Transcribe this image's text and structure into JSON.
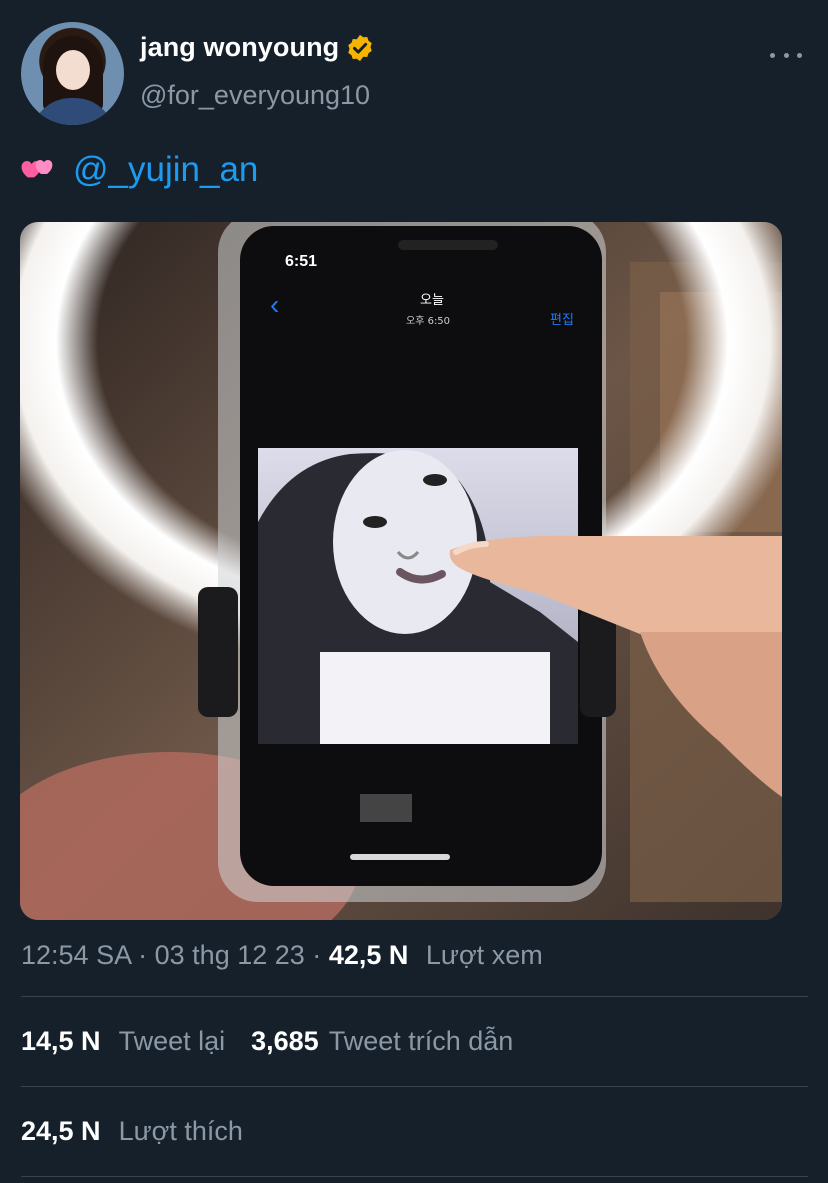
{
  "author": {
    "display_name": "jang wonyoung",
    "handle": "@for_everyoung10",
    "verified_badge_icon": "verified-badge-icon",
    "verified_color": "#f4b400"
  },
  "tweet": {
    "emoji_icon": "two-hearts-emoji",
    "mention": "@_yujin_an"
  },
  "media": {
    "phone_clock": "6:51",
    "album_title": "오늘",
    "album_time": "오후 6:50",
    "edit_label": "편집"
  },
  "meta": {
    "time": "12:54 SA",
    "separator": "·",
    "date": "03 thg 12 23",
    "views_count": "42,5 N",
    "views_label": "Lượt xem"
  },
  "stats": {
    "retweets_count": "14,5 N",
    "retweets_label": "Tweet lại",
    "quotes_count": "3,685",
    "quotes_label": "Tweet trích dẫn",
    "likes_count": "24,5 N",
    "likes_label": "Lượt thích"
  },
  "colors": {
    "background": "#15202b",
    "link": "#1d9bf0",
    "secondary_text": "#8b98a5",
    "divider": "#38444d"
  }
}
